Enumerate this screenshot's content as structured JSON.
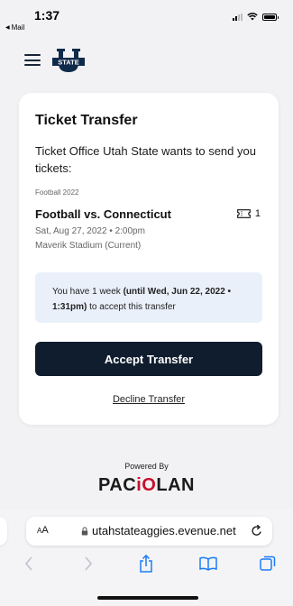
{
  "status_bar": {
    "time": "1:37",
    "back_app": "Mail"
  },
  "header": {
    "logo_text": "STATE",
    "logo_letter": "U"
  },
  "transfer": {
    "title": "Ticket Transfer",
    "message": "Ticket Office Utah State wants to send you tickets:",
    "season": "Football 2022",
    "event_name": "Football vs. Connecticut",
    "ticket_count": "1",
    "event_date": "Sat, Aug 27, 2022 • 2:00pm",
    "venue": "Maverik Stadium (Current)",
    "notice_prefix": "You have 1 week ",
    "notice_deadline": "(until Wed, Jun 22, 2022 • 1:31pm)",
    "notice_suffix": " to accept this transfer",
    "accept_label": "Accept Transfer",
    "decline_label": "Decline Transfer"
  },
  "footer": {
    "powered_by": "Powered By",
    "brand_pac": "PAC",
    "brand_io": "iO",
    "brand_lan": "LAN"
  },
  "browser": {
    "aa_small": "A",
    "aa_large": "A",
    "url": "utahstateaggies.evenue.net"
  },
  "colors": {
    "accent_dark": "#0f1d2e",
    "notice_bg": "#eaf0fa",
    "brand_red": "#c8102e",
    "ios_blue": "#1a7cf5"
  }
}
